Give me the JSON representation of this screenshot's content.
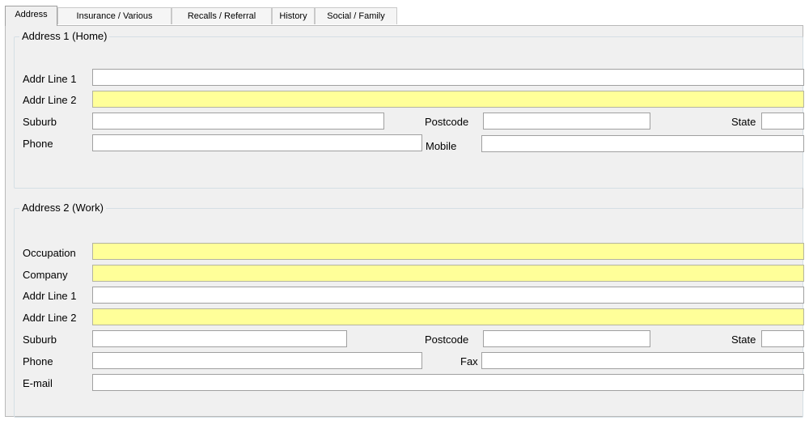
{
  "tabs": [
    "Address",
    "Insurance / Various",
    "Recalls / Referral",
    "History",
    "Social / Family"
  ],
  "active_tab": "Address",
  "home": {
    "legend": "Address 1 (Home)",
    "addr1_label": "Addr Line 1",
    "addr1_value": "",
    "addr2_label": "Addr Line 2",
    "addr2_value": "",
    "suburb_label": "Suburb",
    "suburb_value": "",
    "postcode_label": "Postcode",
    "postcode_value": "",
    "state_label": "State",
    "state_value": "",
    "phone_label": "Phone",
    "phone_value": "",
    "mobile_label": "Mobile",
    "mobile_value": ""
  },
  "work": {
    "legend": "Address 2 (Work)",
    "occupation_label": "Occupation",
    "occupation_value": "",
    "company_label": "Company",
    "company_value": "",
    "addr1_label": "Addr Line 1",
    "addr1_value": "",
    "addr2_label": "Addr Line 2",
    "addr2_value": "",
    "suburb_label": "Suburb",
    "suburb_value": "",
    "postcode_label": "Postcode",
    "postcode_value": "",
    "state_label": "State",
    "state_value": "",
    "phone_label": "Phone",
    "phone_value": "",
    "fax_label": "Fax",
    "fax_value": "",
    "email_label": "E-mail",
    "email_value": ""
  },
  "colors": {
    "required_field": "#ffff99",
    "panel_bg": "#f0f0f0",
    "field_border": "#a0a0a0"
  }
}
